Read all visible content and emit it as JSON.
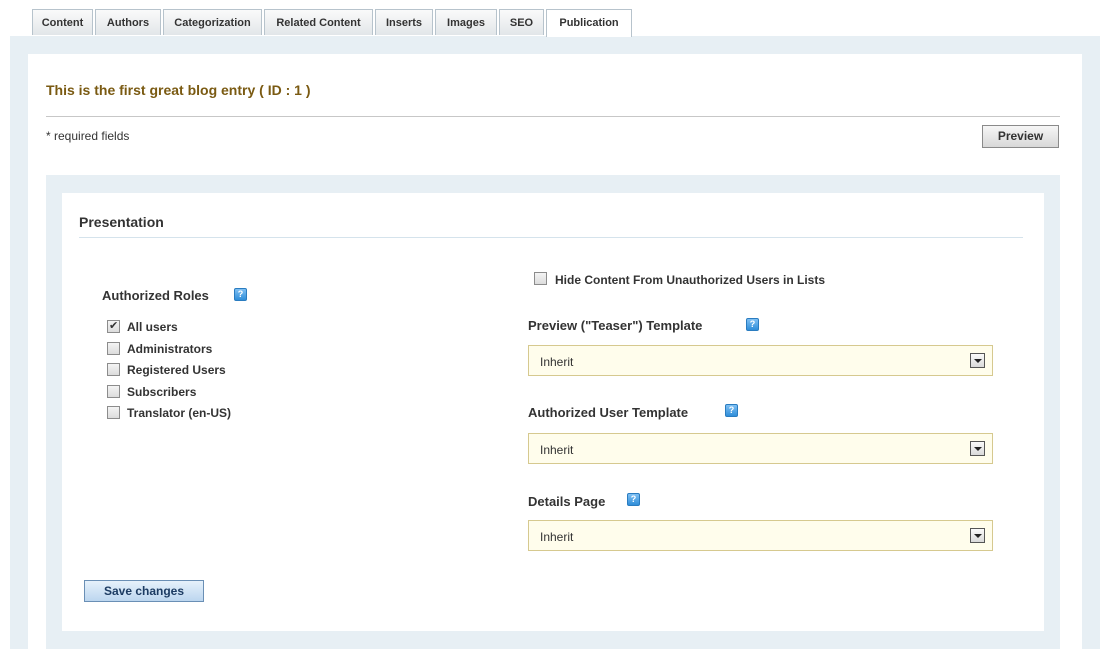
{
  "tabs": [
    {
      "label": "Content"
    },
    {
      "label": "Authors"
    },
    {
      "label": "Categorization"
    },
    {
      "label": "Related Content"
    },
    {
      "label": "Inserts"
    },
    {
      "label": "Images"
    },
    {
      "label": "SEO"
    },
    {
      "label": "Publication",
      "active": true
    }
  ],
  "header": {
    "entry_title": "This is the first great blog entry ( ID : 1 )",
    "required_note": "* required fields",
    "preview_label": "Preview"
  },
  "presentation": {
    "section_title": "Presentation",
    "authorized_roles": {
      "label": "Authorized Roles",
      "roles": [
        {
          "label": "All users",
          "checked": true
        },
        {
          "label": "Administrators",
          "checked": false
        },
        {
          "label": "Registered Users",
          "checked": false
        },
        {
          "label": "Subscribers",
          "checked": false
        },
        {
          "label": "Translator (en-US)",
          "checked": false
        }
      ]
    },
    "hide_content_label": "Hide Content From Unauthorized Users in Lists",
    "hide_content_checked": false,
    "preview_template": {
      "label": "Preview (\"Teaser\") Template",
      "value": "Inherit"
    },
    "authorized_user_template": {
      "label": "Authorized User Template",
      "value": "Inherit"
    },
    "details_page": {
      "label": "Details Page",
      "value": "Inherit"
    },
    "help_icon": "help-icon",
    "save_label": "Save changes"
  },
  "colors": {
    "title": "#7a5a12",
    "frame": "#e7eff4",
    "select_bg": "#fffdec",
    "help_icon": "#2f8ed9"
  }
}
